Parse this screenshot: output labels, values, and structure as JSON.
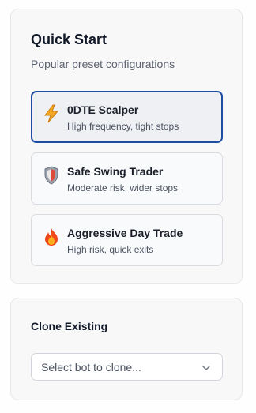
{
  "quick_start": {
    "title": "Quick Start",
    "subtitle": "Popular preset configurations",
    "presets": [
      {
        "name": "0DTE Scalper",
        "description": "High frequency, tight stops",
        "icon": "lightning-icon",
        "selected": true
      },
      {
        "name": "Safe Swing Trader",
        "description": "Moderate risk, wider stops",
        "icon": "shield-icon",
        "selected": false
      },
      {
        "name": "Aggressive Day Trade",
        "description": "High risk, quick exits",
        "icon": "fire-icon",
        "selected": false
      }
    ]
  },
  "clone": {
    "title": "Clone Existing",
    "select_placeholder": "Select bot to clone..."
  },
  "colors": {
    "accent": "#1d4ea3",
    "card_bg": "#f8f8f9",
    "border": "#e5e7eb"
  }
}
